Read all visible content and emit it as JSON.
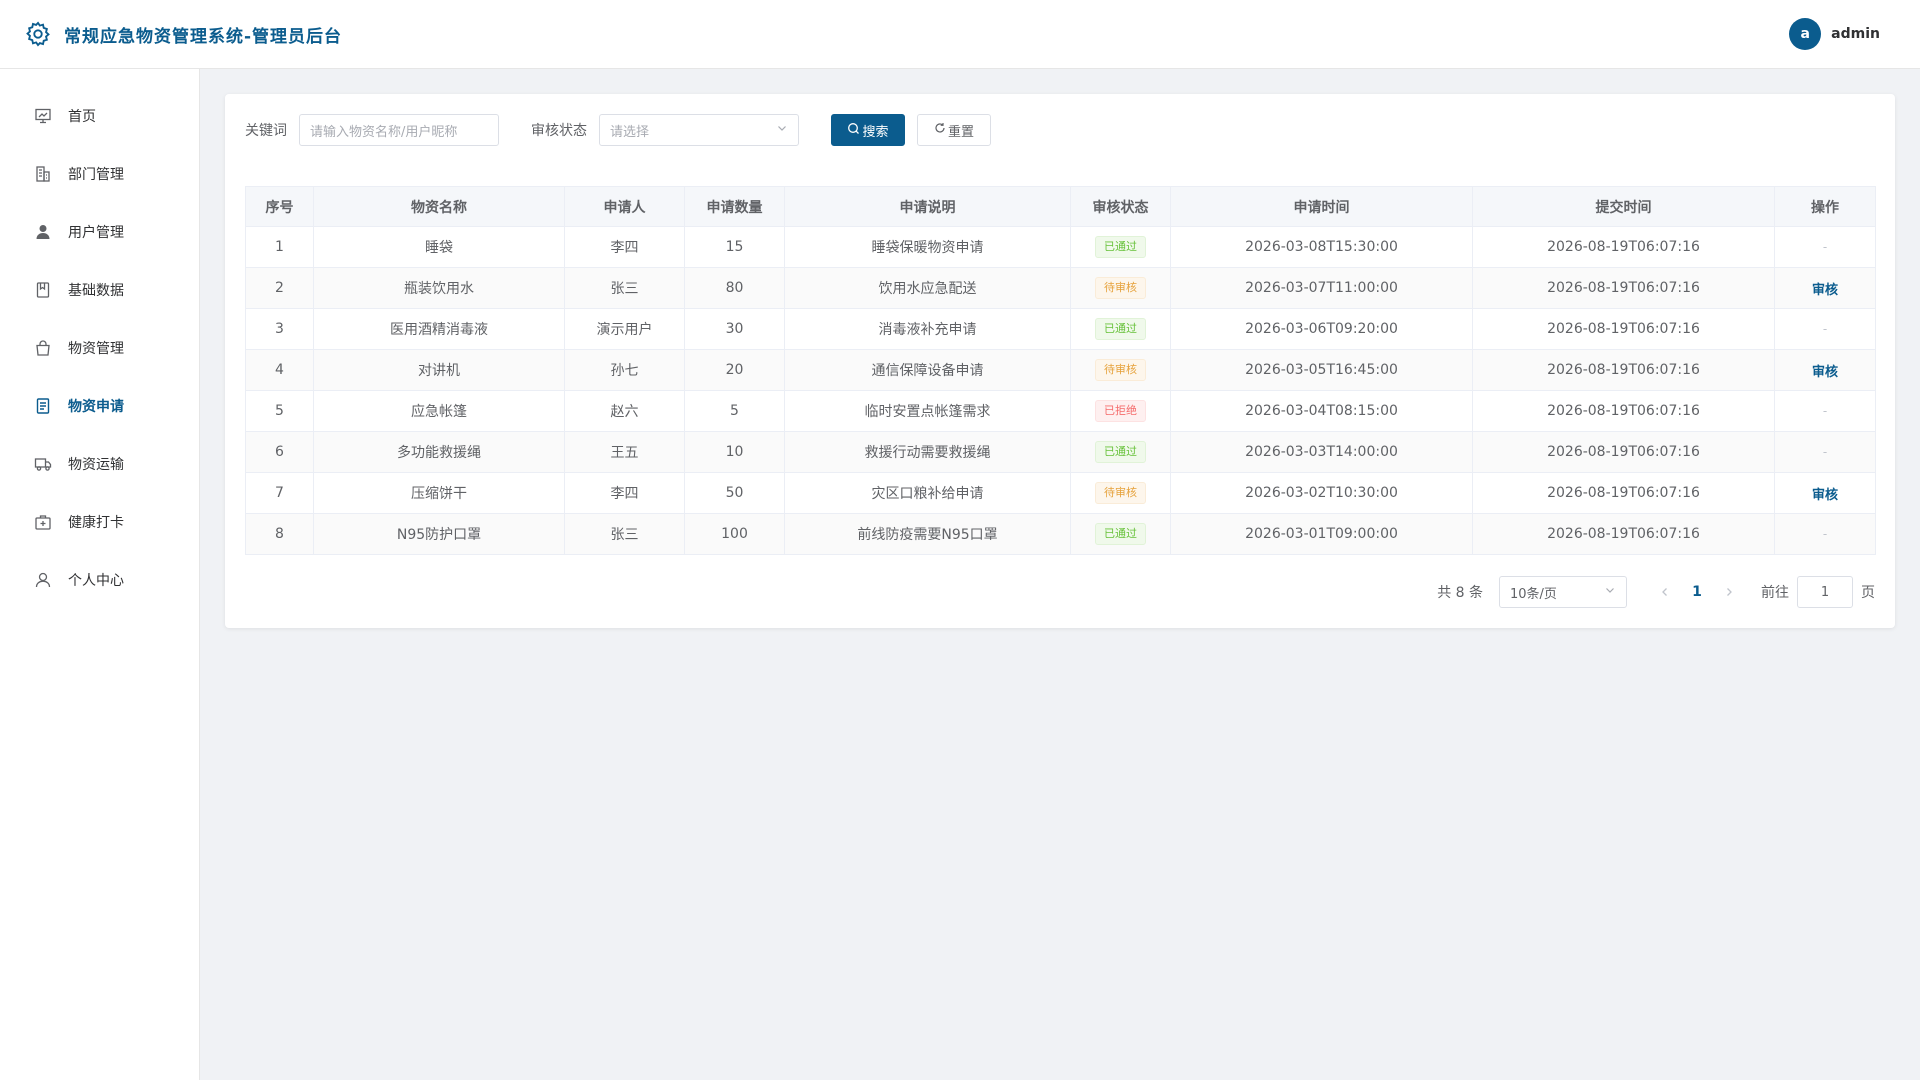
{
  "header": {
    "title": "常规应急物资管理系统-管理员后台",
    "avatar_letter": "a",
    "username": "admin"
  },
  "sidebar": {
    "items": [
      {
        "label": "首页",
        "icon": "dashboard-icon"
      },
      {
        "label": "部门管理",
        "icon": "building-icon"
      },
      {
        "label": "用户管理",
        "icon": "user-icon"
      },
      {
        "label": "基础数据",
        "icon": "book-icon"
      },
      {
        "label": "物资管理",
        "icon": "bag-icon"
      },
      {
        "label": "物资申请",
        "icon": "document-icon",
        "active": true
      },
      {
        "label": "物资运输",
        "icon": "truck-icon"
      },
      {
        "label": "健康打卡",
        "icon": "medical-kit-icon"
      },
      {
        "label": "个人中心",
        "icon": "person-icon"
      }
    ]
  },
  "filters": {
    "keyword_label": "关键词",
    "keyword_placeholder": "请输入物资名称/用户昵称",
    "status_label": "审核状态",
    "status_placeholder": "请选择",
    "search_label": "搜索",
    "reset_label": "重置"
  },
  "table": {
    "columns": [
      "序号",
      "物资名称",
      "申请人",
      "申请数量",
      "申请说明",
      "审核状态",
      "申请时间",
      "提交时间",
      "操作"
    ],
    "rows": [
      {
        "no": "1",
        "name": "睡袋",
        "applicant": "李四",
        "qty": "15",
        "desc": "睡袋保暖物资申请",
        "status": "已通过",
        "status_type": "ok",
        "apply_time": "2026-03-08T15:30:00",
        "submit_time": "2026-08-19T06:07:16",
        "op": "-"
      },
      {
        "no": "2",
        "name": "瓶装饮用水",
        "applicant": "张三",
        "qty": "80",
        "desc": "饮用水应急配送",
        "status": "待审核",
        "status_type": "wait",
        "apply_time": "2026-03-07T11:00:00",
        "submit_time": "2026-08-19T06:07:16",
        "op": "审核"
      },
      {
        "no": "3",
        "name": "医用酒精消毒液",
        "applicant": "演示用户",
        "qty": "30",
        "desc": "消毒液补充申请",
        "status": "已通过",
        "status_type": "ok",
        "apply_time": "2026-03-06T09:20:00",
        "submit_time": "2026-08-19T06:07:16",
        "op": "-"
      },
      {
        "no": "4",
        "name": "对讲机",
        "applicant": "孙七",
        "qty": "20",
        "desc": "通信保障设备申请",
        "status": "待审核",
        "status_type": "wait",
        "apply_time": "2026-03-05T16:45:00",
        "submit_time": "2026-08-19T06:07:16",
        "op": "审核"
      },
      {
        "no": "5",
        "name": "应急帐篷",
        "applicant": "赵六",
        "qty": "5",
        "desc": "临时安置点帐篷需求",
        "status": "已拒绝",
        "status_type": "rej",
        "apply_time": "2026-03-04T08:15:00",
        "submit_time": "2026-08-19T06:07:16",
        "op": "-"
      },
      {
        "no": "6",
        "name": "多功能救援绳",
        "applicant": "王五",
        "qty": "10",
        "desc": "救援行动需要救援绳",
        "status": "已通过",
        "status_type": "ok",
        "apply_time": "2026-03-03T14:00:00",
        "submit_time": "2026-08-19T06:07:16",
        "op": "-"
      },
      {
        "no": "7",
        "name": "压缩饼干",
        "applicant": "李四",
        "qty": "50",
        "desc": "灾区口粮补给申请",
        "status": "待审核",
        "status_type": "wait",
        "apply_time": "2026-03-02T10:30:00",
        "submit_time": "2026-08-19T06:07:16",
        "op": "审核"
      },
      {
        "no": "8",
        "name": "N95防护口罩",
        "applicant": "张三",
        "qty": "100",
        "desc": "前线防疫需要N95口罩",
        "status": "已通过",
        "status_type": "ok",
        "apply_time": "2026-03-01T09:00:00",
        "submit_time": "2026-08-19T06:07:16",
        "op": "-"
      }
    ]
  },
  "pagination": {
    "total_text": "共 8 条",
    "page_size": "10条/页",
    "current_page": "1",
    "goto_label": "前往",
    "goto_value": "1",
    "page_suffix": "页"
  },
  "colors": {
    "primary": "#0b5c8e",
    "success": "#67c23a",
    "warning": "#e6a23c",
    "danger": "#f56c6c"
  }
}
